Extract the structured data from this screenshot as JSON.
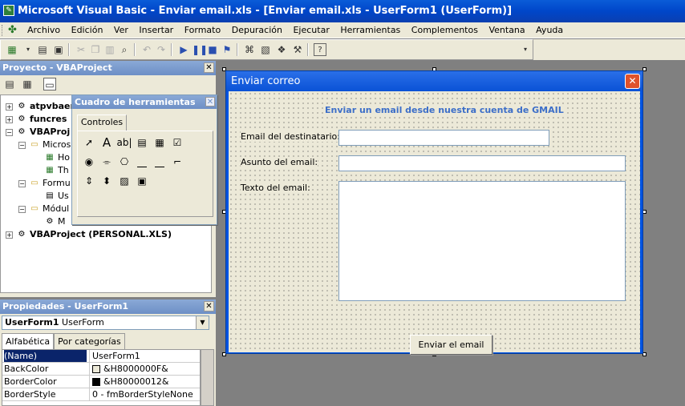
{
  "window": {
    "title": "Microsoft Visual Basic - Enviar email.xls - [Enviar email.xls - UserForm1 (UserForm)]"
  },
  "menu": [
    "Archivo",
    "Edición",
    "Ver",
    "Insertar",
    "Formato",
    "Depuración",
    "Ejecutar",
    "Herramientas",
    "Complementos",
    "Ventana",
    "Ayuda"
  ],
  "project": {
    "title": "Proyecto - VBAProject",
    "tree": [
      {
        "label": "atpvbaen",
        "bold": true
      },
      {
        "label": "funcres",
        "bold": true
      },
      {
        "label": "VBAProj",
        "bold": true
      },
      {
        "label": "Micros",
        "bold": false
      },
      {
        "label": "Ho",
        "bold": false
      },
      {
        "label": "Th",
        "bold": false
      },
      {
        "label": "Formu",
        "bold": false
      },
      {
        "label": "Us",
        "bold": false
      },
      {
        "label": "Módul",
        "bold": false
      },
      {
        "label": "M",
        "bold": false
      },
      {
        "label": "VBAProject (PERSONAL.XLS)",
        "bold": true
      }
    ]
  },
  "toolbox": {
    "title": "Cuadro de herramientas",
    "tab": "Controles"
  },
  "properties": {
    "title": "Propiedades - UserForm1",
    "object_name": "UserForm1",
    "object_type": "UserForm",
    "tabs": [
      "Alfabética",
      "Por categorías"
    ],
    "rows": [
      {
        "key": "(Name)",
        "value": "UserForm1",
        "swatch": null
      },
      {
        "key": "BackColor",
        "value": "&H8000000F&",
        "swatch": "#ece9d8"
      },
      {
        "key": "BorderColor",
        "value": "&H80000012&",
        "swatch": "#000000"
      },
      {
        "key": "BorderStyle",
        "value": "0 - fmBorderStyleNone",
        "swatch": null
      }
    ]
  },
  "form": {
    "title": "Enviar correo",
    "heading": "Enviar un email desde nuestra cuenta de GMAIL",
    "email_label": "Email del destinatario:",
    "subject_label": "Asunto del email:",
    "body_label": "Texto del email:",
    "send_button": "Enviar el email"
  },
  "colors": {
    "titlebar": "#0054e3",
    "heading": "#3c6ec8",
    "selection": "#0a246a"
  }
}
